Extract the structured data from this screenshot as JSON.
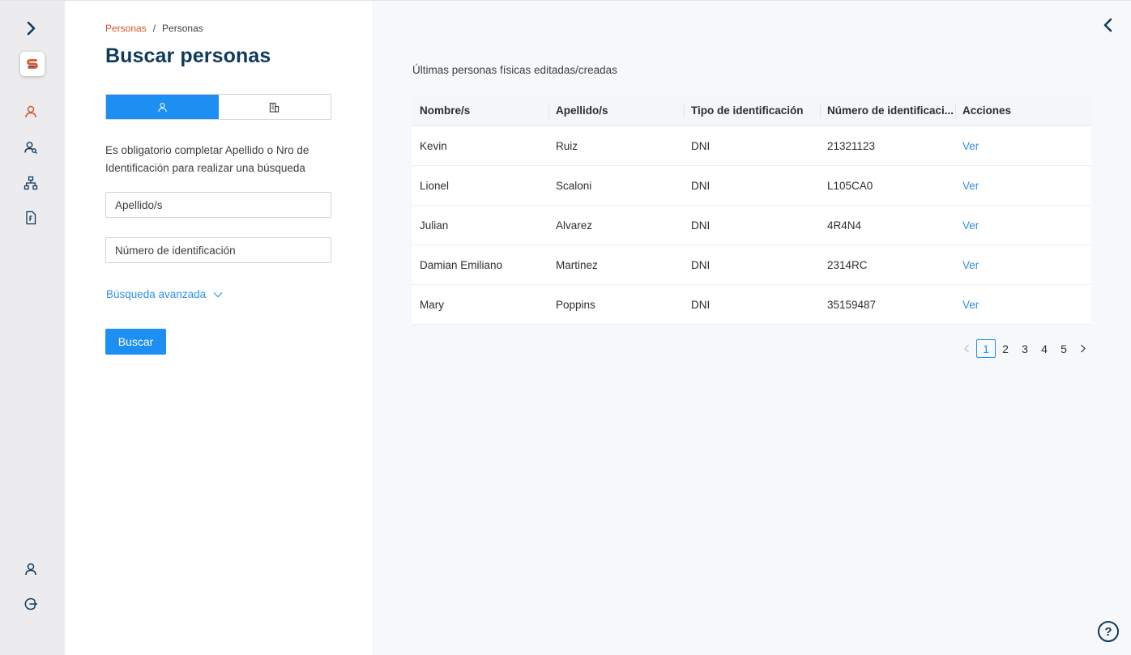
{
  "sidebar": {
    "expand_icon": "chevron-right-icon",
    "logo_letter": "S",
    "nav_icons": [
      "person-icon",
      "people-search-icon",
      "org-chart-icon",
      "document-icon"
    ],
    "bottom_icons": [
      "user-profile-icon",
      "logout-icon"
    ]
  },
  "breadcrumb": {
    "link": "Personas",
    "separator": "/",
    "current": "Personas"
  },
  "page_title": "Buscar personas",
  "segment": {
    "options": [
      "person-icon",
      "building-icon"
    ],
    "active": 0
  },
  "help_text": "Es obligatorio completar Apellido o Nro de Identificación para realizar una búsqueda",
  "fields": {
    "apellido_placeholder": "Apellido/s",
    "numero_placeholder": "Número de identificación"
  },
  "advanced_search": "Búsqueda avanzada",
  "search_button": "Buscar",
  "main": {
    "section_title": "Últimas personas físicas editadas/creadas",
    "table": {
      "headers": [
        "Nombre/s",
        "Apellido/s",
        "Tipo de identificación",
        "Número de identificaci...",
        "Acciones"
      ],
      "rows": [
        [
          "Kevin",
          "Ruiz",
          "DNI",
          "21321123",
          "Ver"
        ],
        [
          "Lionel",
          "Scaloni",
          "DNI",
          "L105CA0",
          "Ver"
        ],
        [
          "Julian",
          "Alvarez",
          "DNI",
          "4R4N4",
          "Ver"
        ],
        [
          "Damian Emiliano",
          "Martinez",
          "DNI",
          "2314RC",
          "Ver"
        ],
        [
          "Mary",
          "Poppins",
          "DNI",
          "35159487",
          "Ver"
        ]
      ]
    },
    "pagination": {
      "pages": [
        "1",
        "2",
        "3",
        "4",
        "5"
      ],
      "current": "1"
    }
  },
  "help_button": "?",
  "colors": {
    "accent": "#1d8ff2",
    "brand_orange": "#d9542b",
    "title_navy": "#0e3a5b",
    "link": "#2f8fe6"
  }
}
